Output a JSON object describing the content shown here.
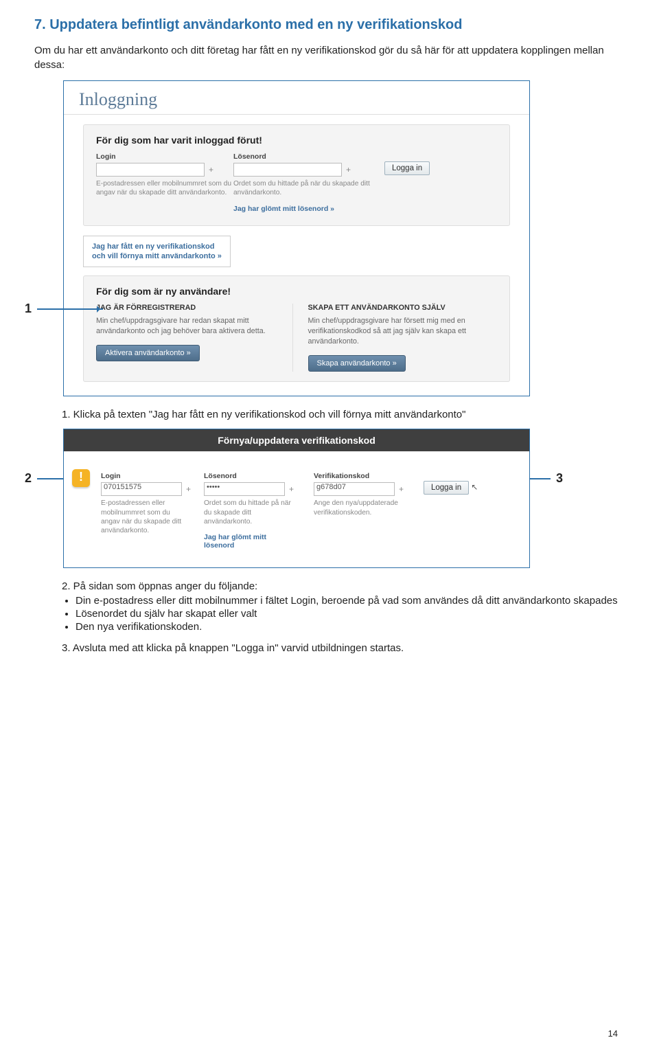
{
  "heading": "7. Uppdatera befintligt användarkonto med en ny verifikationskod",
  "intro": "Om du har ett användarkonto och ditt företag har fått en ny verifikationskod gör du så här för att uppdatera kopplingen mellan dessa:",
  "shot1": {
    "title": "Inloggning",
    "box1_title": "För dig som har varit inloggad förut!",
    "login_label": "Login",
    "login_help": "E-postadressen eller mobilnummret som du angav när du skapade ditt användarkonto.",
    "pw_label": "Lösenord",
    "pw_help": "Ordet som du hittade på när du skapade ditt användarkonto.",
    "login_btn": "Logga in",
    "forgot_link": "Jag har glömt mitt lösenord »",
    "renew_link1": "Jag har fått en ny verifikationskod",
    "renew_link2": "och vill förnya mitt användarkonto »",
    "box2_title": "För dig som är ny användare!",
    "left_head": "JAG ÄR FÖRREGISTRERAD",
    "left_text": "Min chef/uppdragsgivare har redan skapat mitt användarkonto och jag behöver bara aktivera detta.",
    "left_btn": "Aktivera användarkonto »",
    "right_head": "SKAPA ETT ANVÄNDARKONTO SJÄLV",
    "right_text": "Min chef/uppdragsgivare har försett mig med en verifikationskodkod så att jag själv kan skapa ett användarkonto.",
    "right_btn": "Skapa användarkonto »"
  },
  "step1": "1. Klicka på texten \"Jag har fått en ny verifikationskod och vill förnya mitt användarkonto\"",
  "shot2": {
    "title": "Förnya/uppdatera verifikationskod",
    "login_label": "Login",
    "login_val": "070151575",
    "login_help": "E-postadressen eller mobilnummret som du angav när du skapade ditt användarkonto.",
    "pw_label": "Lösenord",
    "pw_val": "•••••",
    "pw_help": "Ordet som du hittade på när du skapade ditt användarkonto.",
    "vk_label": "Verifikationskod",
    "vk_val": "g678d07",
    "vk_help": "Ange den nya/uppdaterade verifikationskoden.",
    "btn": "Logga in",
    "forgot": "Jag har glömt mitt lösenord"
  },
  "step2_intro": "2. På sidan som öppnas anger du följande:",
  "step2_b1": "Din e-postadress eller ditt mobilnummer i fältet Login, beroende på vad som användes då ditt användarkonto skapades",
  "step2_b2": "Lösenordet du själv har skapat eller valt",
  "step2_b3": "Den nya verifikationskoden.",
  "step3": "3. Avsluta med att klicka på knappen \"Logga in\" varvid utbildningen startas.",
  "pagenum": "14",
  "nums": {
    "n1": "1",
    "n2": "2",
    "n3": "3"
  }
}
